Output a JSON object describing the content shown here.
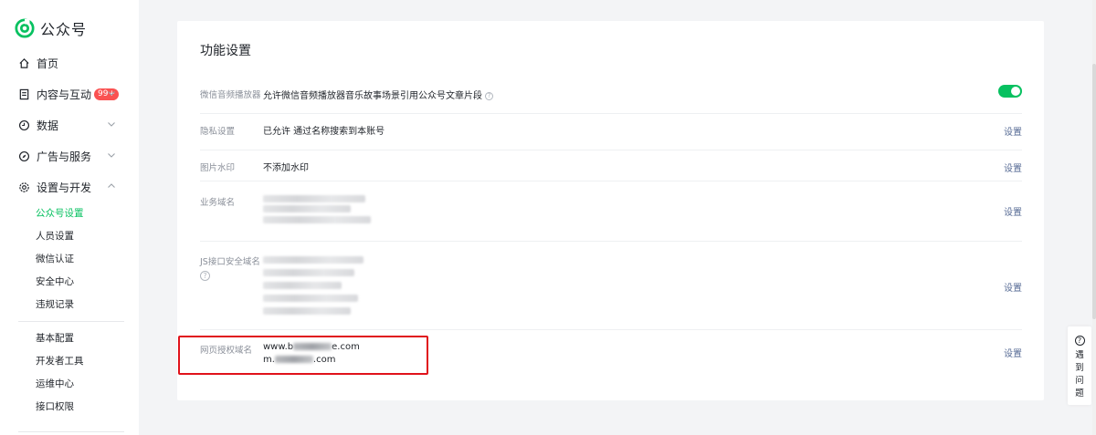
{
  "brand": {
    "name": "公众号",
    "color": "#07c160"
  },
  "sidebar": {
    "items": [
      {
        "label": "首页",
        "icon": "home-icon"
      },
      {
        "label": "内容与互动",
        "icon": "document-icon",
        "badge": "99+"
      },
      {
        "label": "数据",
        "icon": "clock-icon"
      },
      {
        "label": "广告与服务",
        "icon": "compass-icon"
      },
      {
        "label": "设置与开发",
        "icon": "gear-icon"
      }
    ],
    "sub_items": [
      {
        "label": "公众号设置",
        "active": true
      },
      {
        "label": "人员设置"
      },
      {
        "label": "微信认证"
      },
      {
        "label": "安全中心"
      },
      {
        "label": "违规记录"
      }
    ],
    "sub_items_2": [
      {
        "label": "基本配置"
      },
      {
        "label": "开发者工具"
      },
      {
        "label": "运维中心"
      },
      {
        "label": "接口权限"
      }
    ]
  },
  "main": {
    "title": "功能设置",
    "rows": [
      {
        "label": "微信音频播放器",
        "value": "允许微信音频播放器音乐故事场景引用公众号文章片段",
        "toggle_on": true
      },
      {
        "label": "隐私设置",
        "value": "已允许 通过名称搜索到本账号",
        "action": "设置"
      },
      {
        "label": "图片水印",
        "value": "不添加水印",
        "action": "设置"
      },
      {
        "label": "业务域名",
        "action": "设置"
      },
      {
        "label": "JS接口安全域名",
        "action": "设置"
      },
      {
        "label": "网页授权域名",
        "domain_1_prefix": "www.b",
        "domain_1_suffix": "e.com",
        "domain_2_prefix": "m.",
        "domain_2_suffix": ".com",
        "action": "设置"
      }
    ]
  },
  "help": {
    "icon": "question-icon",
    "label": "遇到问题"
  }
}
